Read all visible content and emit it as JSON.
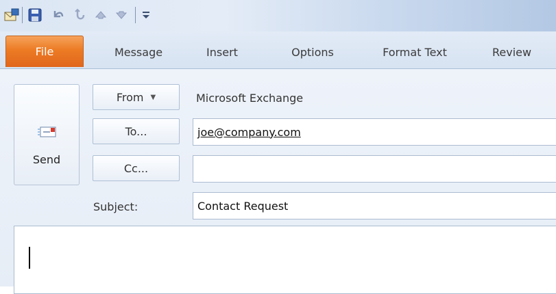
{
  "quick_access_toolbar": {
    "icons": [
      "outlook-envelope-icon",
      "save-icon",
      "undo-icon",
      "redo-icon",
      "previous-item-icon",
      "next-item-icon",
      "customize-toolbar-icon"
    ]
  },
  "ribbon": {
    "tabs": [
      {
        "label": "File"
      },
      {
        "label": "Message"
      },
      {
        "label": "Insert"
      },
      {
        "label": "Options"
      },
      {
        "label": "Format Text"
      },
      {
        "label": "Review"
      }
    ],
    "file_tab_color": "#e8711f"
  },
  "compose": {
    "send_label": "Send",
    "from_label": "From",
    "from_value": "Microsoft Exchange",
    "to_label": "To...",
    "to_value": "joe@company.com",
    "cc_label": "Cc...",
    "cc_value": "",
    "subject_label": "Subject:",
    "subject_value": "Contact Request",
    "body_value": ""
  }
}
